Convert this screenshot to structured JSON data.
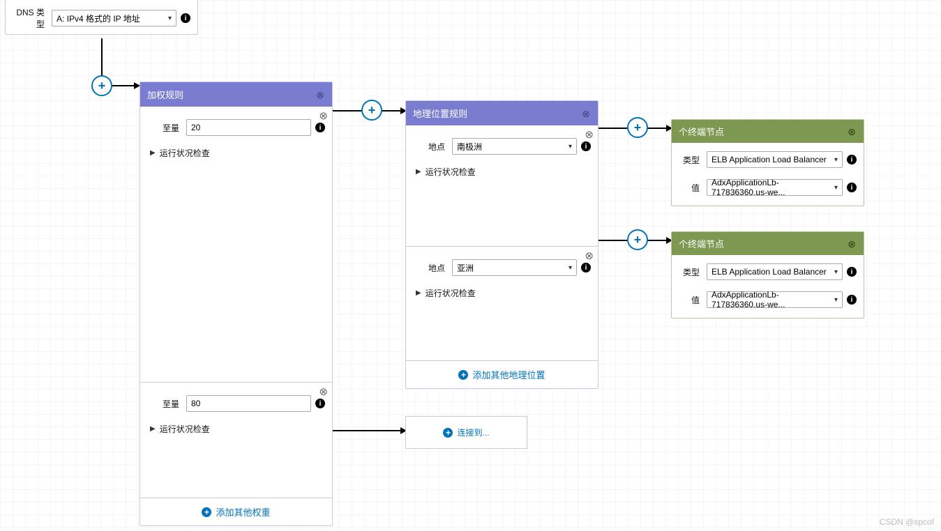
{
  "origin": {
    "dns_type_label": "DNS 类型",
    "dns_type_value": "A: IPv4 格式的 IP 地址"
  },
  "weighted_rule": {
    "title": "加权规则",
    "weight_label": "至量",
    "health_label": "运行状况检查",
    "add_label": "添加其他权重",
    "blocks": [
      {
        "weight": "20"
      },
      {
        "weight": "80"
      }
    ]
  },
  "geo_rule": {
    "title": "地理位置规则",
    "location_label": "地点",
    "health_label": "运行状况检查",
    "add_label": "添加其他地理位置",
    "blocks": [
      {
        "location": "南极洲"
      },
      {
        "location": "亚洲"
      }
    ]
  },
  "endpoint": {
    "title": "个终端节点",
    "type_label": "类型",
    "value_label": "值",
    "type_value": "ELB Application Load Balancer",
    "value_value": "AdxApplicationLb-717836360.us-we..."
  },
  "connect_label": "连接到...",
  "watermark": "CSDN @spcof"
}
